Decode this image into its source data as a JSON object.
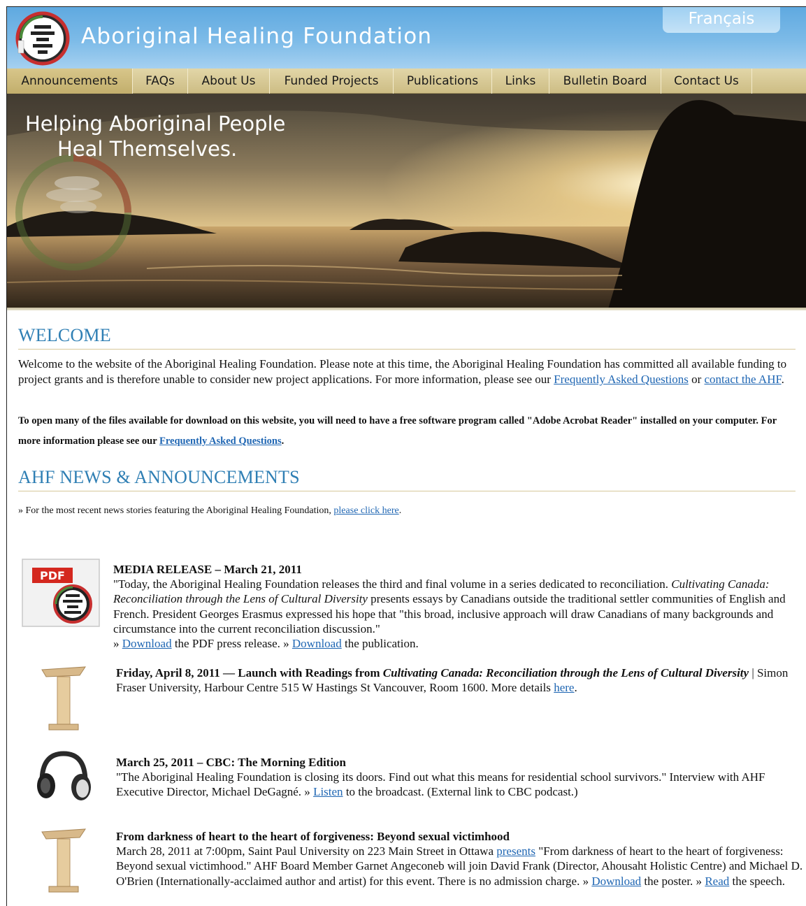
{
  "header": {
    "title": "Aboriginal Healing Foundation",
    "lang_button": "Français"
  },
  "nav": {
    "items": [
      {
        "label": "Announcements",
        "width": 180
      },
      {
        "label": "FAQs",
        "width": 79
      },
      {
        "label": "About Us",
        "width": 117
      },
      {
        "label": "Funded Projects",
        "width": 177
      },
      {
        "label": "Publications",
        "width": 141
      },
      {
        "label": "Links",
        "width": 82
      },
      {
        "label": "Bulletin Board",
        "width": 160
      },
      {
        "label": "Contact Us",
        "width": 130
      }
    ]
  },
  "hero": {
    "line1": "Helping Aboriginal People",
    "line2": "Heal Themselves."
  },
  "welcome": {
    "title": "WELCOME",
    "text": "Welcome to the website of the Aboriginal Healing Foundation. Please note at this time, the Aboriginal Healing Foundation has committed all available funding to project grants and is therefore unable to consider new project applications. For more information, please see our ",
    "faq_link": "Frequently Asked Questions",
    "or": " or ",
    "contact_link": "contact the AHF",
    "end": ".",
    "acrobat_text": "To open many of the files available for download on this website, you will need to have a free software program called \"Adobe Acrobat Reader\" installed on your computer. For more information please see our ",
    "acrobat_link": "Frequently Asked Questions",
    "acrobat_end": "."
  },
  "news": {
    "title": "AHF NEWS & ANNOUNCEMENTS",
    "recent_prefix": "» For the most recent news stories featuring the Aboriginal Healing Foundation, ",
    "recent_link": "please click here",
    "recent_end": ".",
    "items": [
      {
        "icon": "pdf-icon",
        "head": "MEDIA RELEASE – March 21, 2011",
        "body1": "\"Today, the Aboriginal Healing Foundation releases the third and final volume in a series dedicated to reconciliation. ",
        "body_italic": "Cultivating Canada: Reconciliation through the Lens of Cultural Diversity",
        "body2": " presents essays by Canadians outside the traditional settler communities of English and French. President Georges Erasmus expressed his hope that \"this broad, inclusive approach will draw Canadians of many backgrounds and circumstance into the current reconciliation discussion.\"",
        "link1_prefix": "» ",
        "link1": "Download",
        "link1_suffix": " the PDF press release. » ",
        "link2": "Download",
        "link2_suffix": " the publication."
      },
      {
        "icon": "podium-icon",
        "head1": "Friday, April 8, 2011 — Launch with Readings from ",
        "head_italic": "Cultivating Canada: Reconciliation through the Lens of Cultural Diversity",
        "body": " | Simon Fraser University, Harbour Centre 515 W Hastings St Vancouver, Room 1600. More details ",
        "link": "here",
        "end": "."
      },
      {
        "icon": "headphones-icon",
        "head": "March 25, 2011 – CBC: The Morning Edition",
        "body": "\"The Aboriginal Healing Foundation is closing its doors. Find out what this means for residential school survivors.\" Interview with AHF Executive Director, Michael DeGagné. » ",
        "link": "Listen",
        "end": " to the broadcast. (External link to CBC podcast.)"
      },
      {
        "icon": "podium-icon",
        "head": "From darkness of heart to the heart of forgiveness: Beyond sexual victimhood",
        "body1": "March 28, 2011 at 7:00pm, Saint Paul University on 223 Main Street in Ottawa ",
        "link0": "presents",
        "body2": " \"From darkness of heart to the heart of forgiveness: Beyond sexual victimhood.\" AHF Board Member Garnet Angeconeb will join David Frank (Director, Ahousaht Holistic Centre) and Michael D. O'Brien (Internationally-acclaimed author and artist) for this event. There is no admission charge. » ",
        "link1": "Download",
        "mid": " the poster. » ",
        "link2": "Read",
        "end": " the speech."
      }
    ]
  },
  "colors": {
    "header_blue": "#6fb3e5",
    "nav_tan": "#d8c998",
    "heading_blue": "#2f7fb4",
    "link_blue": "#1f66b3"
  }
}
